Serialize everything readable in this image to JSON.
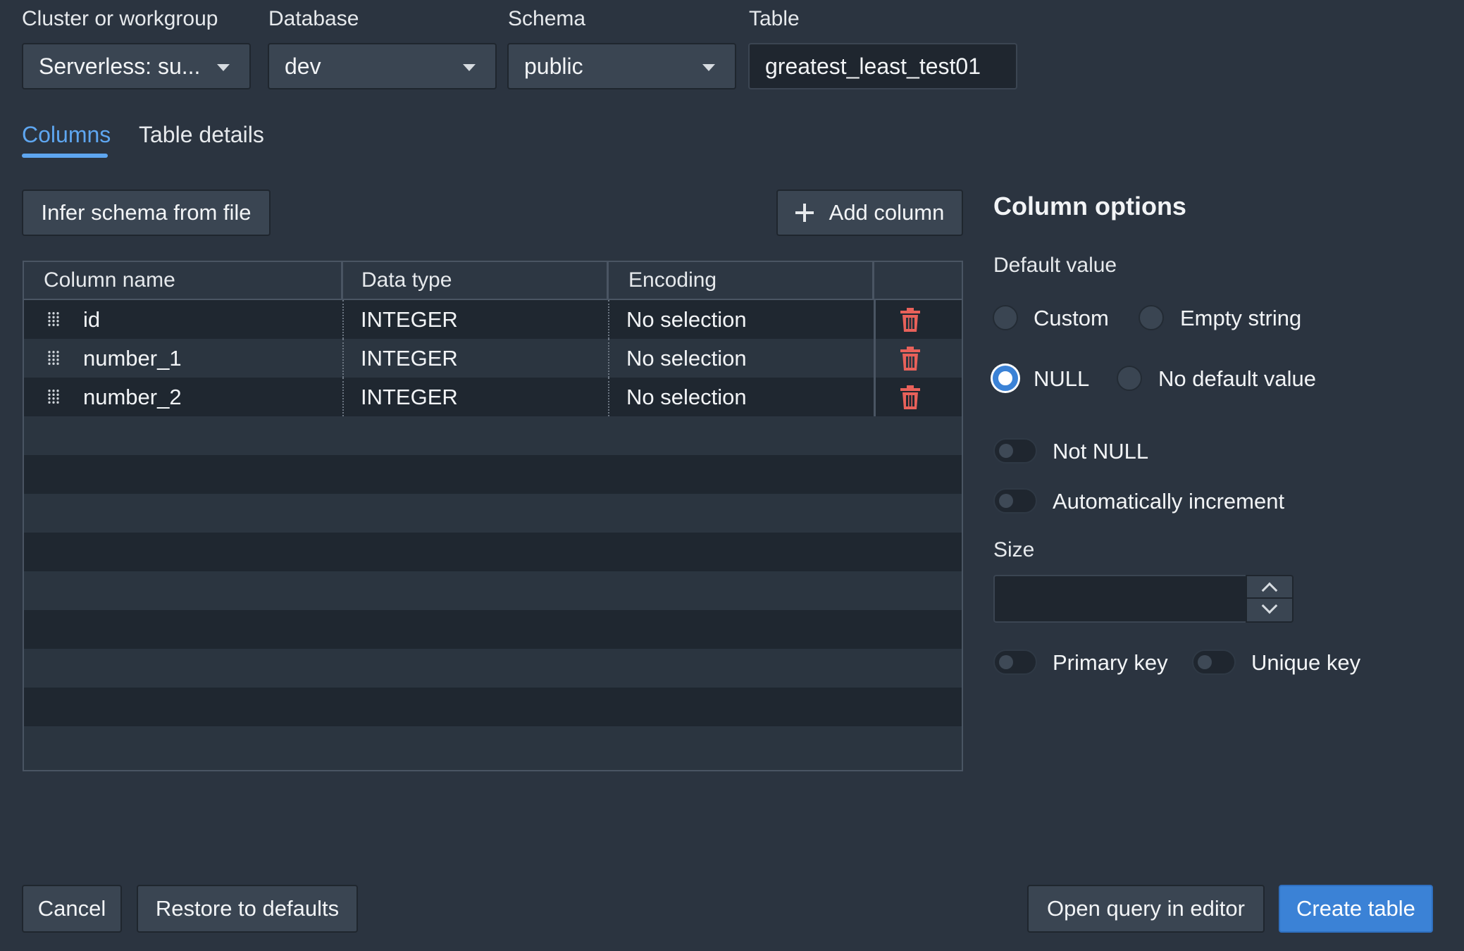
{
  "fields": {
    "cluster_label": "Cluster or workgroup",
    "cluster_value": "Serverless: su...",
    "database_label": "Database",
    "database_value": "dev",
    "schema_label": "Schema",
    "schema_value": "public",
    "table_label": "Table",
    "table_value": "greatest_least_test01"
  },
  "tabs": [
    {
      "label": "Columns",
      "active": true
    },
    {
      "label": "Table details",
      "active": false
    }
  ],
  "toolbar": {
    "infer_label": "Infer schema from file",
    "add_column_label": "Add column"
  },
  "table": {
    "headers": [
      "Column name",
      "Data type",
      "Encoding"
    ],
    "rows": [
      {
        "name": "id",
        "type": "INTEGER",
        "encoding": "No selection"
      },
      {
        "name": "number_1",
        "type": "INTEGER",
        "encoding": "No selection"
      },
      {
        "name": "number_2",
        "type": "INTEGER",
        "encoding": "No selection"
      }
    ]
  },
  "column_options": {
    "title": "Column options",
    "default_value_label": "Default value",
    "radio_custom": "Custom",
    "radio_empty_string": "Empty string",
    "radio_null": "NULL",
    "radio_no_default": "No default value",
    "selected_default": "NULL",
    "toggle_not_null": "Not NULL",
    "toggle_auto_increment": "Automatically increment",
    "size_label": "Size",
    "size_value": "",
    "toggle_primary_key": "Primary key",
    "toggle_unique_key": "Unique key"
  },
  "footer": {
    "cancel_label": "Cancel",
    "restore_label": "Restore to defaults",
    "open_query_label": "Open query in editor",
    "create_label": "Create table"
  },
  "colors": {
    "accent": "#3b82d6",
    "tab_active": "#5ea6f0",
    "delete": "#e8615a",
    "background": "#2b3440"
  },
  "icons": [
    "caret-down-icon",
    "plus-icon",
    "drag-handle-icon",
    "trash-icon",
    "chevron-up-icon",
    "chevron-down-icon"
  ]
}
